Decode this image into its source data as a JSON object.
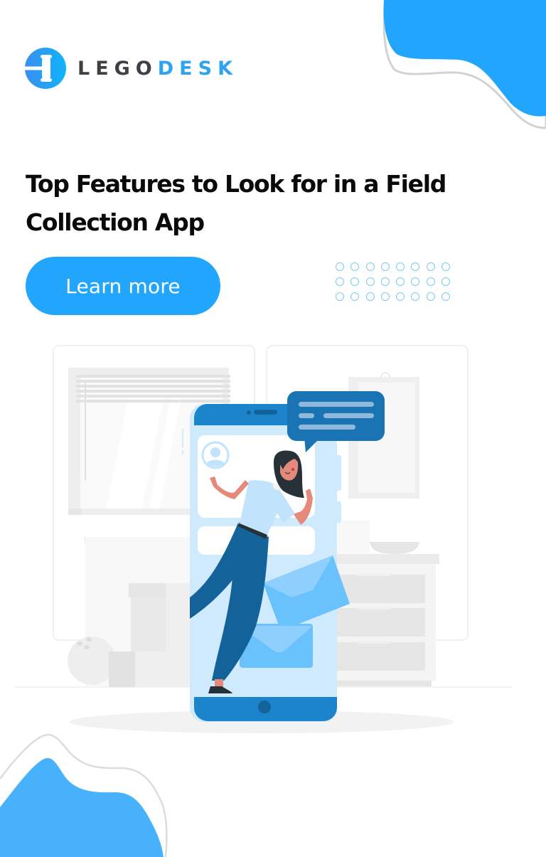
{
  "brand": {
    "name_part1": "LEGO",
    "name_part2": "DESK",
    "logo_icon": "gavel-icon",
    "colors": {
      "primary_blue": "#22a6fd",
      "logo_dark": "#3d4145",
      "logo_blue": "#2ea3f2"
    }
  },
  "headline": "Top Features to Look for in a Field Collection App",
  "cta": {
    "label": "Learn more",
    "color": "#22a6fd"
  },
  "decor": {
    "dot_grid": {
      "rows": 3,
      "cols": 8,
      "color": "#7cc8f7"
    },
    "blob_color_top": "#22a6fd",
    "blob_color_bottom": "#47b2fb"
  },
  "illustration": {
    "subject": "woman stepping out of a smartphone with envelopes and a chat bubble",
    "icons": [
      "smartphone-icon",
      "chat-bubble-icon",
      "user-avatar-icon",
      "envelope-icon"
    ],
    "colors": {
      "phone_dark": "#1c84cb",
      "phone_light": "#d3ebfd",
      "bubble": "#1a73b3",
      "pants": "#13639a",
      "skin": "#e58a7b",
      "hair": "#263238",
      "envelope": "#69c2fc"
    }
  }
}
